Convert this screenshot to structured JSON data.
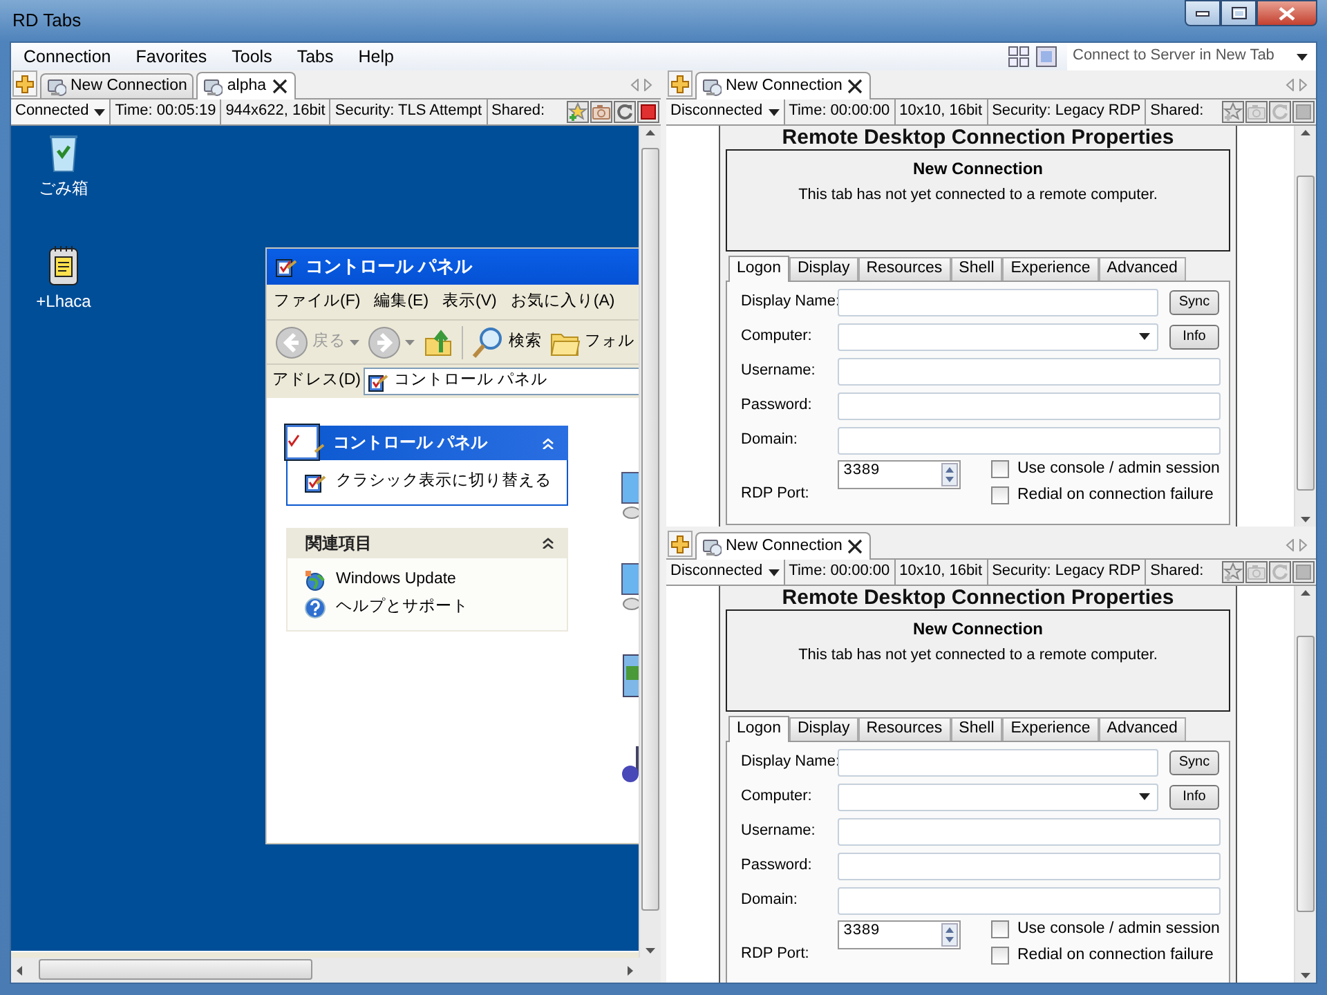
{
  "window": {
    "title": "RD Tabs"
  },
  "menu": [
    {
      "label": "Connection"
    },
    {
      "label": "Favorites"
    },
    {
      "label": "Tools"
    },
    {
      "label": "Tabs"
    },
    {
      "label": "Help"
    }
  ],
  "connect_combo": {
    "value": "Connect to Server in New Tab"
  },
  "panes": [
    {
      "kind": "session",
      "tabs": [
        {
          "label": "New Connection",
          "selected": false
        },
        {
          "label": "alpha",
          "selected": true
        }
      ],
      "status": {
        "state": "Connected",
        "time": "Time: 00:05:19",
        "display": "944x622, 16bit",
        "security": "Security: TLS Attempt",
        "shared": "Shared:"
      },
      "actions_disabled": false,
      "desktop": {
        "icons": [
          {
            "label": "ごみ箱",
            "kind": "recycle"
          },
          {
            "label": "+Lhaca",
            "kind": "archive"
          }
        ],
        "explorer": {
          "title": "コントロール パネル",
          "menu": [
            "ファイル(F)",
            "編集(E)",
            "表示(V)",
            "お気に入り(A)"
          ],
          "toolbar": [
            {
              "kind": "back",
              "label": "戻る",
              "disabled": true
            },
            {
              "kind": "forward",
              "disabled": true
            },
            {
              "kind": "up",
              "disabled": false
            },
            {
              "kind": "search",
              "label": "検索",
              "disabled": false
            },
            {
              "kind": "folders",
              "label": "フォル",
              "disabled": false
            }
          ],
          "address_label": "アドレス(D)",
          "address": "コントロール パネル",
          "task_panels": [
            {
              "kind": "primary",
              "title": "コントロール パネル",
              "links": [
                {
                  "kind": "applet",
                  "label": "クラシック表示に切り替える"
                }
              ]
            },
            {
              "kind": "secondary",
              "title": "関連項目",
              "links": [
                {
                  "kind": "update",
                  "label": "Windows Update"
                },
                {
                  "kind": "help",
                  "label": "ヘルプとサポート"
                }
              ]
            }
          ]
        }
      }
    },
    {
      "kind": "properties",
      "tabs": [
        {
          "label": "New Connection",
          "selected": true
        }
      ],
      "status": {
        "state": "Disconnected",
        "time": "Time: 00:00:00",
        "display": "10x10, 16bit",
        "security": "Security: Legacy RDP",
        "shared": "Shared:"
      },
      "actions_disabled": true,
      "properties": {
        "heading": "Remote Desktop Connection Properties",
        "info_title": "New Connection",
        "info_text": "This tab has not yet connected to a remote computer.",
        "tabs": [
          {
            "label": "Logon",
            "selected": true
          },
          {
            "label": "Display",
            "selected": false
          },
          {
            "label": "Resources",
            "selected": false
          },
          {
            "label": "Shell",
            "selected": false
          },
          {
            "label": "Experience",
            "selected": false
          },
          {
            "label": "Advanced",
            "selected": false
          }
        ],
        "fields": [
          {
            "kind": "text",
            "label": "Display Name:",
            "button": "Sync"
          },
          {
            "kind": "combo",
            "label": "Computer:",
            "button": "Info"
          },
          {
            "kind": "text",
            "label": "Username:"
          },
          {
            "kind": "text",
            "label": "Password:"
          },
          {
            "kind": "text",
            "label": "Domain:"
          },
          {
            "kind": "spinner",
            "label": "RDP Port:",
            "value": "3389"
          }
        ],
        "options": [
          {
            "label": "Use console / admin session",
            "checked": false
          },
          {
            "label": "Redial on connection failure",
            "checked": false
          }
        ]
      }
    },
    {
      "kind": "properties",
      "tabs": [
        {
          "label": "New Connection",
          "selected": true
        }
      ],
      "status": {
        "state": "Disconnected",
        "time": "Time: 00:00:00",
        "display": "10x10, 16bit",
        "security": "Security: Legacy RDP",
        "shared": "Shared:"
      },
      "actions_disabled": true,
      "properties": {
        "heading": "Remote Desktop Connection Properties",
        "info_title": "New Connection",
        "info_text": "This tab has not yet connected to a remote computer.",
        "tabs": [
          {
            "label": "Logon",
            "selected": true
          },
          {
            "label": "Display",
            "selected": false
          },
          {
            "label": "Resources",
            "selected": false
          },
          {
            "label": "Shell",
            "selected": false
          },
          {
            "label": "Experience",
            "selected": false
          },
          {
            "label": "Advanced",
            "selected": false
          }
        ],
        "fields": [
          {
            "kind": "text",
            "label": "Display Name:",
            "button": "Sync"
          },
          {
            "kind": "combo",
            "label": "Computer:",
            "button": "Info"
          },
          {
            "kind": "text",
            "label": "Username:"
          },
          {
            "kind": "text",
            "label": "Password:"
          },
          {
            "kind": "text",
            "label": "Domain:"
          },
          {
            "kind": "spinner",
            "label": "RDP Port:",
            "value": "3389"
          }
        ],
        "options": [
          {
            "label": "Use console / admin session",
            "checked": false
          },
          {
            "label": "Redial on connection failure",
            "checked": false
          }
        ]
      }
    }
  ]
}
